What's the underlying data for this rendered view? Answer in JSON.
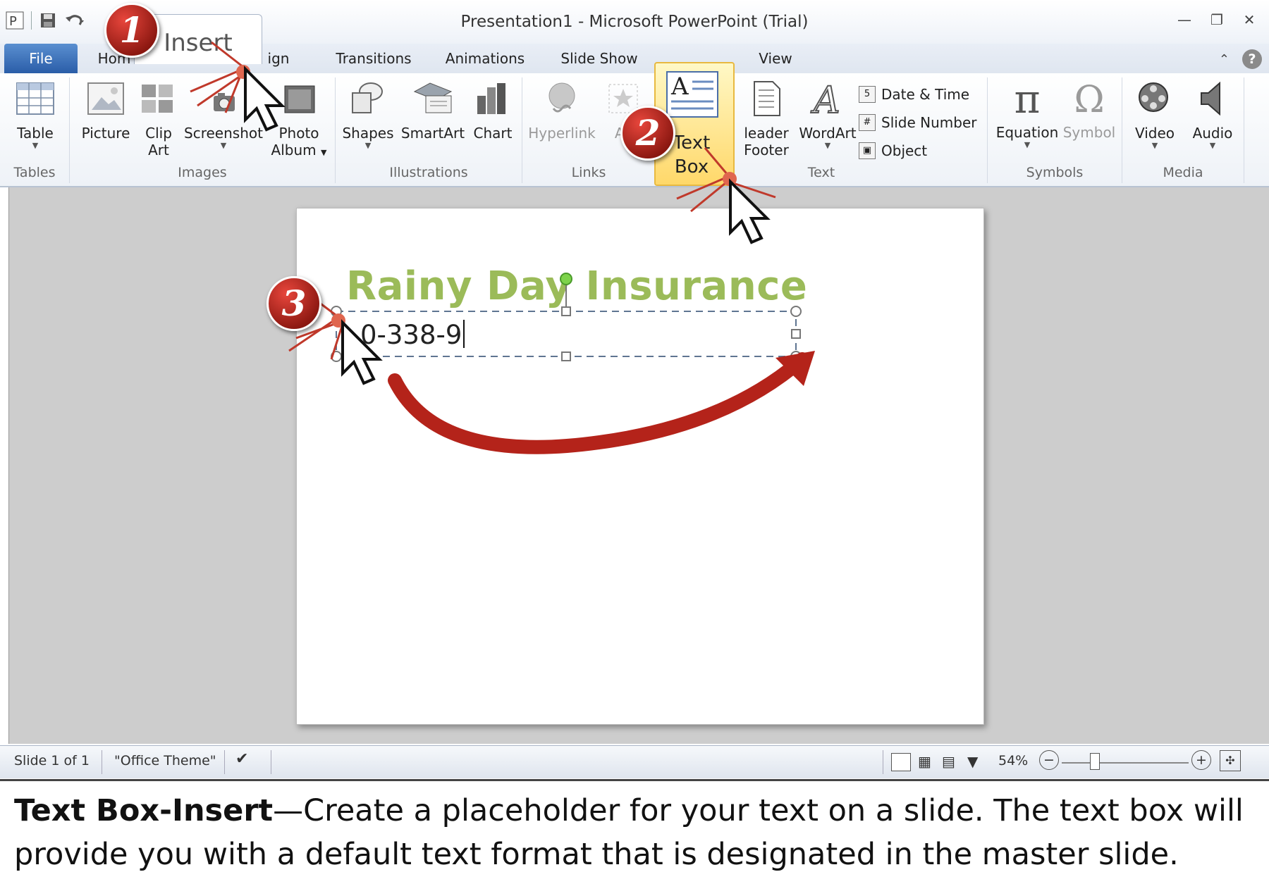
{
  "window": {
    "title": "Presentation1  -  Microsoft PowerPoint (Trial)"
  },
  "ribbon_tabs": {
    "file": "File",
    "home": "Hom",
    "insert": "Insert",
    "design": "ign",
    "transitions": "Transitions",
    "animations": "Animations",
    "slide_show": "Slide Show",
    "view": "View"
  },
  "groups": {
    "tables": "Tables",
    "images": "Images",
    "illustrations": "Illustrations",
    "links": "Links",
    "text": "Text",
    "symbols": "Symbols",
    "media": "Media"
  },
  "commands": {
    "table": "Table",
    "picture": "Picture",
    "clip_art_1": "Clip",
    "clip_art_2": "Art",
    "screenshot": "Screenshot",
    "photo_album_1": "Photo",
    "photo_album_2": "Album",
    "shapes": "Shapes",
    "smartart": "SmartArt",
    "chart": "Chart",
    "hyperlink": "Hyperlink",
    "action": "Ac",
    "text_box_1": "Text",
    "text_box_2": "Box",
    "header_footer_1": "leader",
    "header_footer_2": "Footer",
    "wordart": "WordArt",
    "date_time": "Date & Time",
    "slide_number": "Slide Number",
    "object": "Object",
    "equation": "Equation",
    "symbol": "Symbol",
    "video": "Video",
    "audio": "Audio"
  },
  "slide": {
    "title": "Rainy Day Insurance",
    "textbox_text": "0-338-9"
  },
  "statusbar": {
    "slide_info": "Slide 1 of 1",
    "theme": "\"Office Theme\"",
    "zoom": "54%"
  },
  "callouts": {
    "step1": "1",
    "step2": "2",
    "step3": "3"
  },
  "caption": {
    "bold": "Text Box-Insert",
    "line1": "—Create a placeholder for your text on a slide.  The text box will",
    "line2": "provide you with a default text format that is designated in the master slide."
  },
  "colors": {
    "title_green": "#9bbb59",
    "callout_red": "#b4231a",
    "highlight_gold": "#ffd86a"
  }
}
